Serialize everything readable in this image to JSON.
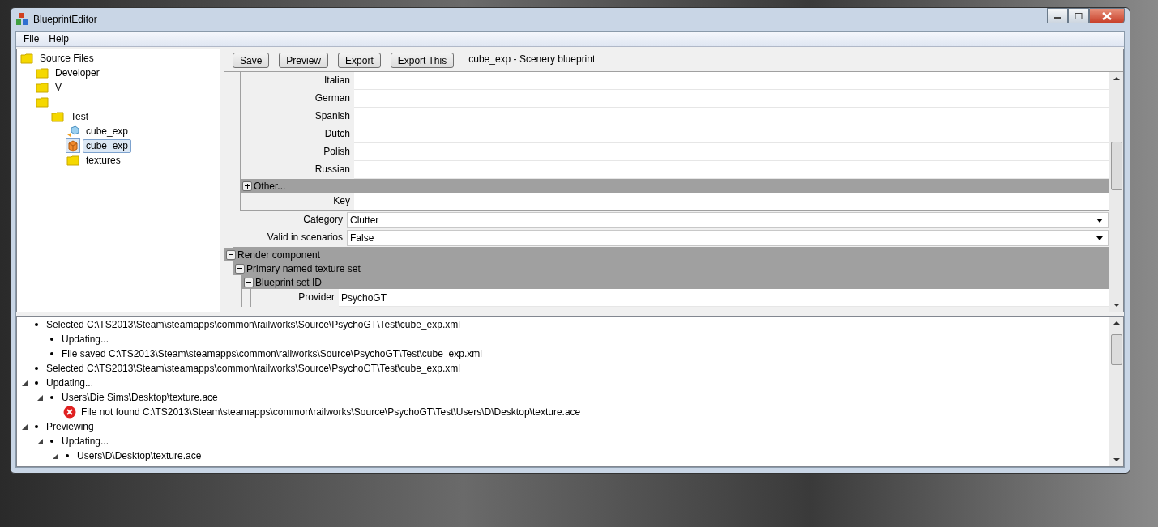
{
  "window": {
    "title": "BlueprintEditor"
  },
  "menu": [
    {
      "label": "File"
    },
    {
      "label": "Help"
    }
  ],
  "tree": [
    {
      "label": "Source Files",
      "kind": "folder",
      "selected": false,
      "children": [
        {
          "label": "Developer",
          "kind": "folder",
          "selected": false
        },
        {
          "label": "V",
          "kind": "folder",
          "selected": false
        },
        {
          "kind": "folder",
          "selected": false,
          "children": [
            {
              "label": "Test",
              "kind": "folder",
              "selected": false,
              "children": [
                {
                  "label": "cube_exp",
                  "kind": "export",
                  "selected": false
                },
                {
                  "label": "cube_exp",
                  "kind": "cube",
                  "selected": true
                },
                {
                  "label": "textures",
                  "kind": "folder",
                  "selected": false
                }
              ]
            }
          ]
        }
      ]
    }
  ],
  "toolbar": {
    "buttons": [
      "Save",
      "Preview",
      "Export",
      "Export This"
    ],
    "caption": "cube_exp - Scenery blueprint"
  },
  "properties": [
    {
      "kind": "section",
      "children": [
        {
          "kind": "section",
          "children": [
            {
              "kind": "field",
              "label": "Italian"
            },
            {
              "kind": "field",
              "label": "German"
            },
            {
              "kind": "field",
              "label": "Spanish"
            },
            {
              "kind": "field",
              "label": "Dutch"
            },
            {
              "kind": "field",
              "label": "Polish"
            },
            {
              "kind": "field",
              "label": "Russian"
            },
            {
              "kind": "group",
              "label": "Other...",
              "expanded": false
            },
            {
              "kind": "field",
              "label": "Key"
            }
          ]
        },
        {
          "kind": "dropdown",
          "label": "Category",
          "value": "Clutter"
        },
        {
          "kind": "dropdown",
          "label": "Valid in scenarios",
          "value": "False"
        }
      ]
    },
    {
      "kind": "group",
      "label": "Render component",
      "expanded": true,
      "children": [
        {
          "kind": "group",
          "label": "Primary named texture set",
          "expanded": true,
          "children": [
            {
              "kind": "group",
              "label": "Blueprint set ID",
              "expanded": true,
              "children": [
                {
                  "kind": "field",
                  "label": "Provider",
                  "value": "PsychoGT"
                }
              ]
            }
          ]
        }
      ]
    }
  ],
  "log": [
    {
      "kind": "bullet",
      "text": "Selected C:\\TS2013\\Steam\\steamapps\\common\\railworks\\Source\\PsychoGT\\Test\\cube_exp.xml",
      "children": [
        {
          "kind": "bullet",
          "text": "Updating..."
        },
        {
          "kind": "bullet",
          "text": "File saved C:\\TS2013\\Steam\\steamapps\\common\\railworks\\Source\\PsychoGT\\Test\\cube_exp.xml"
        }
      ]
    },
    {
      "kind": "bullet",
      "text": "Selected C:\\TS2013\\Steam\\steamapps\\common\\railworks\\Source\\PsychoGT\\Test\\cube_exp.xml"
    },
    {
      "kind": "bullet",
      "text": "Updating...",
      "expanded": true,
      "children": [
        {
          "kind": "bullet",
          "text": "Users\\Die Sims\\Desktop\\texture.ace",
          "expanded": true,
          "children": [
            {
              "kind": "error",
              "text": "File not found C:\\TS2013\\Steam\\steamapps\\common\\railworks\\Source\\PsychoGT\\Test\\Users\\D\\Desktop\\texture.ace"
            }
          ]
        }
      ]
    },
    {
      "kind": "bullet",
      "text": "Previewing",
      "expanded": true,
      "children": [
        {
          "kind": "bullet",
          "text": "Updating...",
          "expanded": true,
          "children": [
            {
              "kind": "bullet",
              "text": "Users\\D\\Desktop\\texture.ace",
              "expanded": true
            }
          ]
        }
      ]
    }
  ]
}
